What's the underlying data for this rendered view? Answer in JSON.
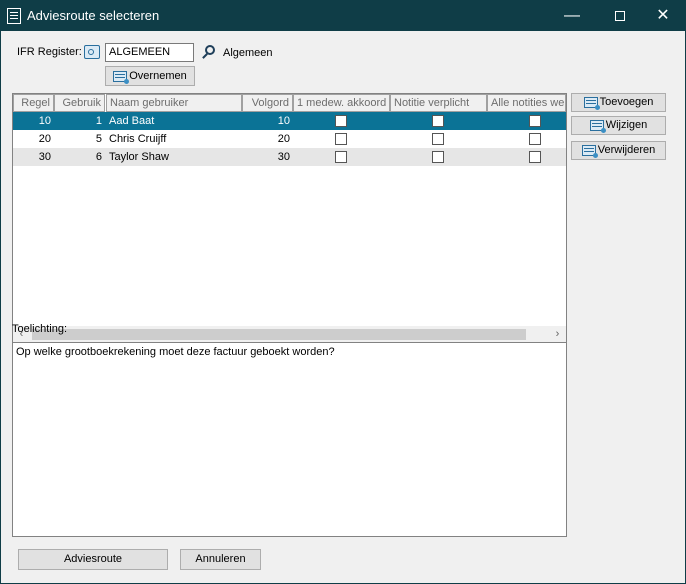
{
  "window": {
    "title": "Adviesroute selecteren"
  },
  "form": {
    "register_label": "IFR Register:",
    "register_value": "ALGEMEEN",
    "register_desc": "Algemeen",
    "overnemen_label": "Overnemen"
  },
  "grid": {
    "columns": [
      "Regel",
      "Gebruik",
      "Naam gebruiker",
      "Volgord",
      "1 medew. akkoord",
      "Notitie verplicht",
      "Alle notities we"
    ],
    "rows": [
      {
        "regel": "10",
        "gebruiker": "1",
        "naam": "Aad Baat",
        "volgorde": "10",
        "selected": true
      },
      {
        "regel": "20",
        "gebruiker": "5",
        "naam": "Chris Cruijff",
        "volgorde": "20",
        "selected": false
      },
      {
        "regel": "30",
        "gebruiker": "6",
        "naam": "Taylor Shaw",
        "volgorde": "30",
        "selected": false
      }
    ]
  },
  "side_buttons": {
    "add": "Toevoegen",
    "edit": "Wijzigen",
    "delete": "Verwijderen"
  },
  "toelichting": {
    "label": "Toelichting:",
    "text": "Op welke grootboekrekening moet deze factuur geboekt worden?"
  },
  "footer": {
    "adviesroute": "Adviesroute",
    "annuleren": "Annuleren"
  },
  "colors": {
    "titlebar": "#0f3d47",
    "selection": "#0b7396",
    "stripe": "#e6e6e6"
  }
}
